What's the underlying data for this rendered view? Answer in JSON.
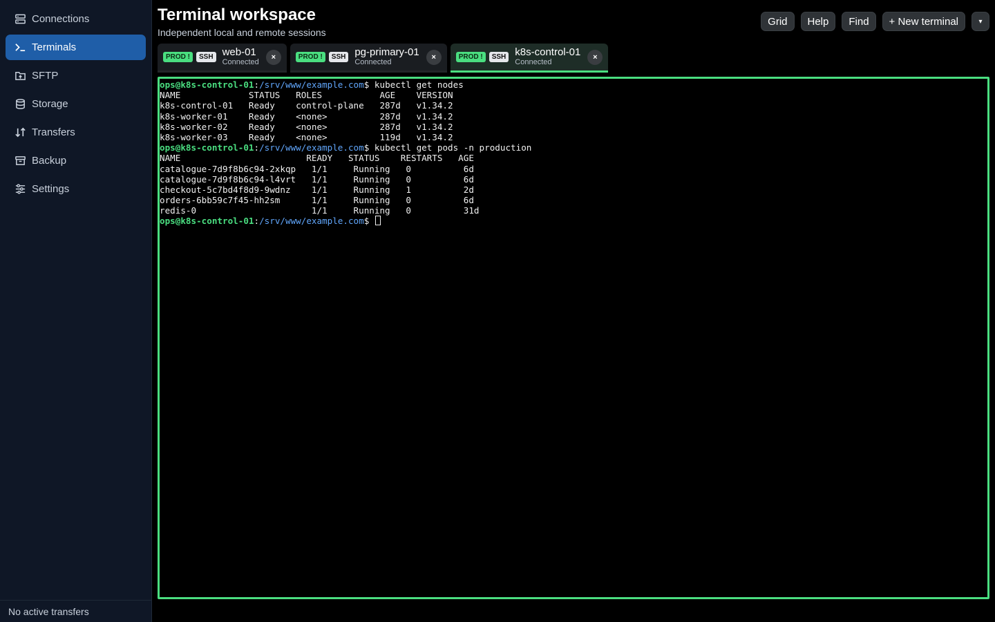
{
  "sidebar": {
    "items": [
      {
        "label": "Connections",
        "icon": "server-icon"
      },
      {
        "label": "Terminals",
        "icon": "terminal-icon"
      },
      {
        "label": "SFTP",
        "icon": "folder-upload-icon"
      },
      {
        "label": "Storage",
        "icon": "database-icon"
      },
      {
        "label": "Transfers",
        "icon": "transfer-arrows-icon"
      },
      {
        "label": "Backup",
        "icon": "archive-icon"
      },
      {
        "label": "Settings",
        "icon": "sliders-icon"
      }
    ],
    "active_index": 1,
    "footer": "No active transfers"
  },
  "header": {
    "title": "Terminal workspace",
    "subtitle": "Independent local and remote sessions"
  },
  "toolbar": {
    "grid": "Grid",
    "help": "Help",
    "find": "Find",
    "new_terminal": "+ New terminal",
    "caret": "▾"
  },
  "tabs": [
    {
      "env": "PROD !",
      "proto": "SSH",
      "name": "web-01",
      "status": "Connected",
      "close": "×"
    },
    {
      "env": "PROD !",
      "proto": "SSH",
      "name": "pg-primary-01",
      "status": "Connected",
      "close": "×"
    },
    {
      "env": "PROD !",
      "proto": "SSH",
      "name": "k8s-control-01",
      "status": "Connected",
      "close": "×"
    }
  ],
  "active_tab_index": 2,
  "terminal": {
    "prompt_user": "ops@k8s-control-01",
    "prompt_sep": ":",
    "prompt_path": "/srv/www/example.com",
    "prompt_end": "$ ",
    "lines": [
      {
        "type": "cmd",
        "text": "kubectl get nodes"
      },
      {
        "type": "out",
        "text": "NAME             STATUS   ROLES           AGE    VERSION"
      },
      {
        "type": "out",
        "text": "k8s-control-01   Ready    control-plane   287d   v1.34.2"
      },
      {
        "type": "out",
        "text": "k8s-worker-01    Ready    <none>          287d   v1.34.2"
      },
      {
        "type": "out",
        "text": "k8s-worker-02    Ready    <none>          287d   v1.34.2"
      },
      {
        "type": "out",
        "text": "k8s-worker-03    Ready    <none>          119d   v1.34.2"
      },
      {
        "type": "cmd",
        "text": "kubectl get pods -n production"
      },
      {
        "type": "out",
        "text": "NAME                        READY   STATUS    RESTARTS   AGE"
      },
      {
        "type": "out",
        "text": "catalogue-7d9f8b6c94-2xkqp   1/1     Running   0          6d"
      },
      {
        "type": "out",
        "text": "catalogue-7d9f8b6c94-l4vrt   1/1     Running   0          6d"
      },
      {
        "type": "out",
        "text": "checkout-5c7bd4f8d9-9wdnz    1/1     Running   1          2d"
      },
      {
        "type": "out",
        "text": "orders-6bb59c7f45-hh2sm      1/1     Running   0          6d"
      },
      {
        "type": "out",
        "text": "redis-0                      1/1     Running   0          31d"
      },
      {
        "type": "prompt",
        "text": ""
      }
    ]
  },
  "colors": {
    "accent": "#1f5ea8",
    "prod_green": "#4ade80",
    "path_blue": "#60a5fa"
  }
}
